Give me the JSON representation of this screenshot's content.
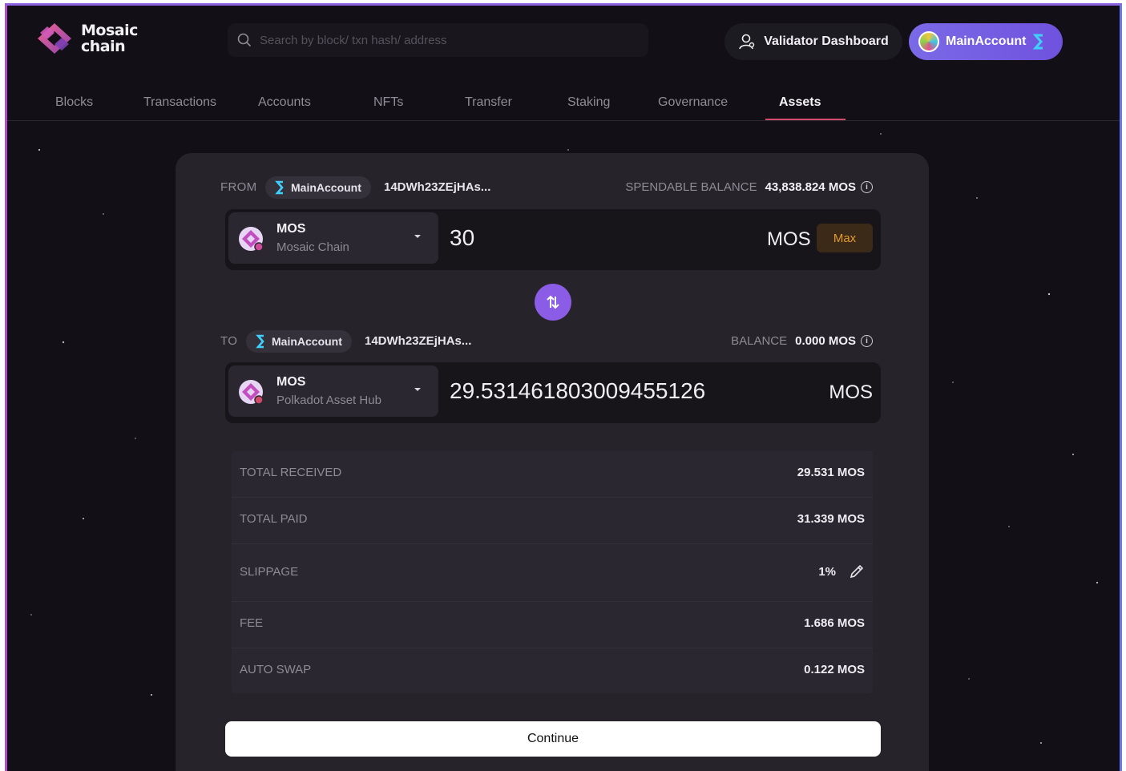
{
  "brand": {
    "line1": "Mosaic",
    "line2": "chain"
  },
  "search": {
    "placeholder": "Search by block/ txn hash/ address"
  },
  "header": {
    "validator_label": "Validator Dashboard",
    "account_label": "MainAccount"
  },
  "nav": {
    "items": [
      "Blocks",
      "Transactions",
      "Accounts",
      "NFTs",
      "Transfer",
      "Staking",
      "Governance",
      "Assets"
    ],
    "active": "Assets"
  },
  "from": {
    "label": "FROM",
    "account": "MainAccount",
    "address": "14DWh23ZEjHAs...",
    "balance_label": "SPENDABLE BALANCE",
    "balance_value": "43,838.824 MOS",
    "token": "MOS",
    "network": "Mosaic Chain",
    "amount": "30",
    "unit": "MOS",
    "max_label": "Max"
  },
  "to": {
    "label": "TO",
    "account": "MainAccount",
    "address": "14DWh23ZEjHAs...",
    "balance_label": "BALANCE",
    "balance_value": "0.000 MOS",
    "token": "MOS",
    "network": "Polkadot Asset Hub",
    "amount": "29.531461803009455126",
    "unit": "MOS"
  },
  "summary": [
    {
      "label": "TOTAL RECEIVED",
      "value": "29.531 MOS"
    },
    {
      "label": "TOTAL PAID",
      "value": "31.339 MOS"
    },
    {
      "label": "SLIPPAGE",
      "value": "1%"
    },
    {
      "label": "FEE",
      "value": "1.686 MOS"
    },
    {
      "label": "AUTO SWAP",
      "value": "0.122 MOS"
    }
  ],
  "continue_label": "Continue",
  "colors": {
    "background": "#121016",
    "card": "#26232b",
    "accent_purple": "#8b5ce6",
    "nav_active_underline": "#d24a6a",
    "max_text": "#e59a2b"
  }
}
